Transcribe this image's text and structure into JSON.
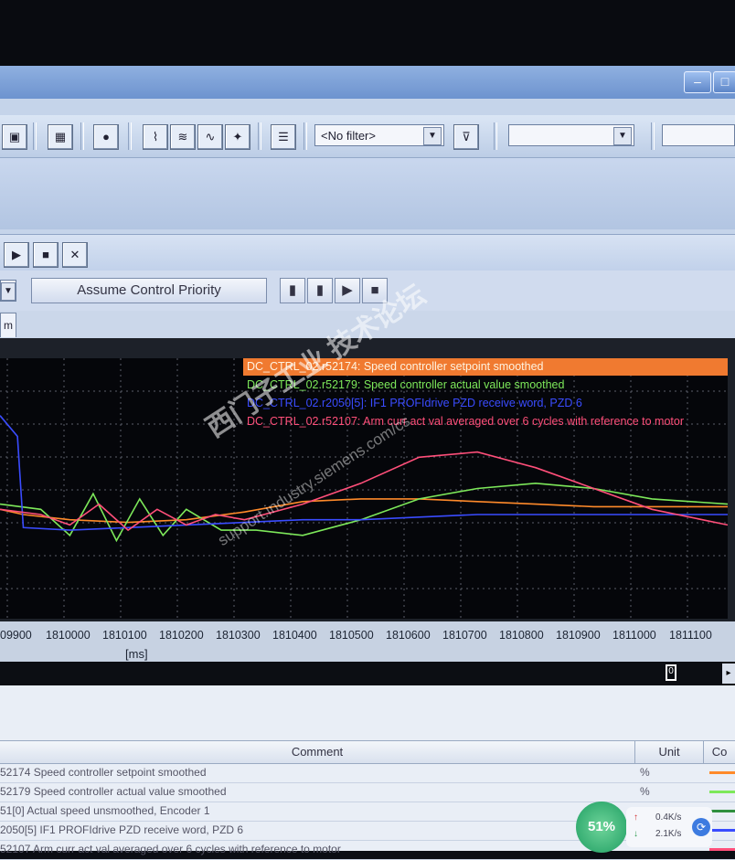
{
  "toolbar": {
    "filter_value": "<No filter>",
    "filter_options_value": "",
    "extra_combo_value": ""
  },
  "toolbar3": {
    "assume_priority_label": "Assume Control Priority"
  },
  "tabs": [
    {
      "label": "m"
    }
  ],
  "legend": [
    {
      "text": "DC_CTRL_02.r52174: Speed controller setpoint smoothed",
      "color": "#ff8a2a"
    },
    {
      "text": "DC_CTRL_02.r52179: Speed controller actual value smoothed",
      "color": "#7de85a"
    },
    {
      "text": "DC_CTRL_02.r2050[5]: IF1 PROFIdrive PZD receive word, PZD 6",
      "color": "#3a4cff"
    },
    {
      "text": "DC_CTRL_02.r52107: Arm curr act val averaged over 6 cycles with reference to motor",
      "color": "#ff4f7a"
    }
  ],
  "chart_data": {
    "type": "line",
    "x_ticks": [
      "09900",
      "1810000",
      "1810100",
      "1810200",
      "1810300",
      "1810400",
      "1810500",
      "1810600",
      "1810700",
      "1810800",
      "1810900",
      "1811000",
      "1811100"
    ],
    "xlabel": "[ms]",
    "grid": true,
    "xlim": [
      1809880,
      1811130
    ],
    "series": [
      {
        "name": "DC_CTRL_02.r52174: Speed controller setpoint smoothed",
        "color": "#ff8a2a",
        "x": [
          1809880,
          1809920,
          1810000,
          1810100,
          1810200,
          1810300,
          1810400,
          1810500,
          1810600,
          1810700,
          1810800,
          1810900,
          1811000,
          1811130
        ],
        "y": [
          0.42,
          0.4,
          0.38,
          0.37,
          0.38,
          0.41,
          0.45,
          0.46,
          0.46,
          0.45,
          0.44,
          0.43,
          0.43,
          0.43
        ]
      },
      {
        "name": "DC_CTRL_02.r52179: Speed controller actual value smoothed",
        "color": "#7de85a",
        "x": [
          1809880,
          1809950,
          1810000,
          1810040,
          1810080,
          1810120,
          1810160,
          1810200,
          1810260,
          1810320,
          1810400,
          1810500,
          1810600,
          1810700,
          1810800,
          1810900,
          1811000,
          1811130
        ],
        "y": [
          0.44,
          0.42,
          0.32,
          0.48,
          0.3,
          0.46,
          0.32,
          0.42,
          0.34,
          0.34,
          0.32,
          0.38,
          0.46,
          0.5,
          0.52,
          0.5,
          0.46,
          0.44
        ]
      },
      {
        "name": "DC_CTRL_02.r2050[5]: IF1 PROFIdrive PZD receive word, PZD 6",
        "color": "#3a4cff",
        "x": [
          1809880,
          1809910,
          1809920,
          1810000,
          1810100,
          1810200,
          1810300,
          1810400,
          1810500,
          1810600,
          1810700,
          1810800,
          1810900,
          1811000,
          1811130
        ],
        "y": [
          0.78,
          0.7,
          0.35,
          0.34,
          0.35,
          0.36,
          0.37,
          0.38,
          0.38,
          0.39,
          0.4,
          0.4,
          0.4,
          0.4,
          0.4
        ]
      },
      {
        "name": "DC_CTRL_02.r52107: Arm curr act val averaged over 6 cycles with reference to motor",
        "color": "#ff4f7a",
        "x": [
          1809880,
          1809950,
          1810000,
          1810050,
          1810100,
          1810150,
          1810200,
          1810250,
          1810300,
          1810400,
          1810500,
          1810600,
          1810700,
          1810800,
          1810900,
          1811000,
          1811130
        ],
        "y": [
          0.42,
          0.4,
          0.36,
          0.44,
          0.34,
          0.42,
          0.36,
          0.4,
          0.38,
          0.44,
          0.52,
          0.62,
          0.64,
          0.58,
          0.5,
          0.42,
          0.36
        ]
      }
    ]
  },
  "grid_table": {
    "headers": {
      "comment": "Comment",
      "unit": "Unit",
      "color": "Co"
    },
    "rows": [
      {
        "comment": "52174  Speed controller setpoint smoothed",
        "unit": "%",
        "color": "#ff8a2a"
      },
      {
        "comment": "52179  Speed controller actual value smoothed",
        "unit": "%",
        "color": "#7de85a"
      },
      {
        "comment": "51[0]  Actual speed unsmoothed, Encoder 1",
        "unit": "",
        "color": "#2e8f3e"
      },
      {
        "comment": "2050[5]  IF1 PROFIdrive PZD receive word, PZD 6",
        "unit": "",
        "color": "#3a4cff"
      },
      {
        "comment": "52107  Arm curr act val averaged over 6 cycles with reference to motor",
        "unit": "",
        "color": "#ff4f7a"
      }
    ]
  },
  "taskbar": {
    "cpu_percent": "51%",
    "upload": "0.4K/s",
    "download": "2.1K/s"
  },
  "watermark": {
    "line1": "西门子工业 技术论坛",
    "line2": "support.industry.siemens.com/cs"
  },
  "scroll_marker": "0"
}
